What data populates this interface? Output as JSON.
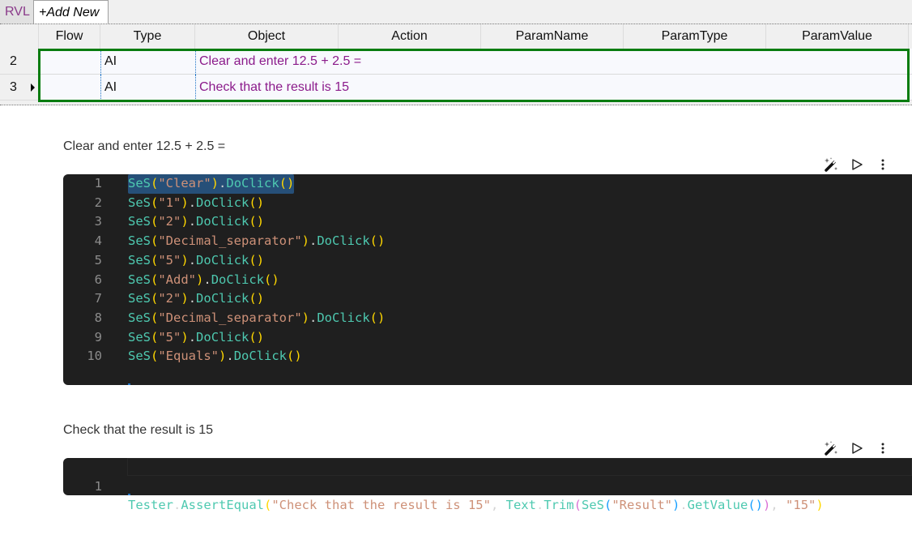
{
  "tabs": [
    {
      "label": "RVL"
    },
    {
      "label": "+Add New"
    }
  ],
  "grid": {
    "columns": [
      "Flow",
      "Type",
      "Object",
      "Action",
      "ParamName",
      "ParamType",
      "ParamValue"
    ],
    "rows": [
      {
        "number": "2",
        "flow": "",
        "type": "AI",
        "object": "Clear and enter 12.5 + 2.5 =",
        "action": "",
        "param_name": "",
        "param_type": "",
        "param_value": "",
        "current": false
      },
      {
        "number": "3",
        "flow": "",
        "type": "AI",
        "object": "Check that the result is 15",
        "action": "",
        "param_name": "",
        "param_type": "",
        "param_value": "",
        "current": true
      }
    ],
    "selection_color": "#087c10"
  },
  "cells": [
    {
      "title": "Clear and enter 12.5 + 2.5 =",
      "toolbar": {
        "generate_icon": "magic-wand-icon",
        "run_icon": "play-icon",
        "more_icon": "more-vertical-icon"
      },
      "lines": [
        {
          "n": "1",
          "arg": "\"Clear\"",
          "method": "DoClick",
          "selected": true
        },
        {
          "n": "2",
          "arg": "\"1\"",
          "method": "DoClick"
        },
        {
          "n": "3",
          "arg": "\"2\"",
          "method": "DoClick"
        },
        {
          "n": "4",
          "arg": "\"Decimal_separator\"",
          "method": "DoClick"
        },
        {
          "n": "5",
          "arg": "\"5\"",
          "method": "DoClick"
        },
        {
          "n": "6",
          "arg": "\"Add\"",
          "method": "DoClick"
        },
        {
          "n": "7",
          "arg": "\"2\"",
          "method": "DoClick"
        },
        {
          "n": "8",
          "arg": "\"Decimal_separator\"",
          "method": "DoClick"
        },
        {
          "n": "9",
          "arg": "\"5\"",
          "method": "DoClick"
        },
        {
          "n": "10",
          "arg": "\"Equals\"",
          "method": "DoClick"
        }
      ]
    },
    {
      "title": "Check that the result is 15",
      "toolbar": {
        "generate_icon": "magic-wand-icon",
        "run_icon": "play-icon",
        "more_icon": "more-vertical-icon"
      },
      "lines": [
        {
          "n": "1",
          "code": "Tester.AssertEqual(\"Check that the result is 15\", Text.Trim(SeS(\"Result\").GetValue()), \"15\")"
        }
      ]
    }
  ],
  "code_tokens": {
    "ses": "SeS",
    "dot": ".",
    "lparen": "(",
    "rparen": ")",
    "tester": "Tester",
    "assert": "AssertEqual",
    "assert_msg": "\"Check that the result is 15\"",
    "comma": ", ",
    "text": "Text",
    "trim": "Trim",
    "result_arg": "\"Result\"",
    "getvalue": "GetValue",
    "expected": "\"15\""
  },
  "colors": {
    "code_bg": "#1f1f1f",
    "function": "#4ec9b0",
    "string": "#ce9178",
    "bracket_1": "#ffd700",
    "bracket_2": "#da70d6",
    "bracket_3": "#179fff",
    "selection": "#264f78",
    "object_text": "#8b1b8b"
  }
}
